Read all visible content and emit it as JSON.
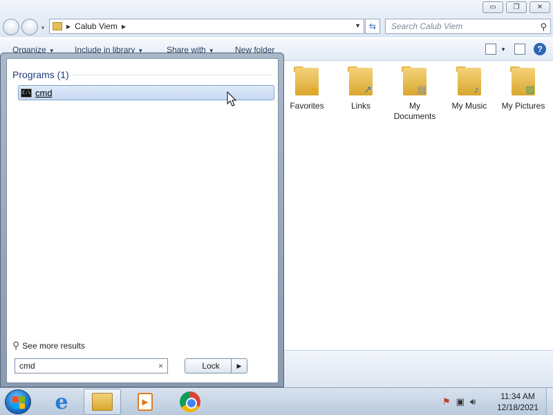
{
  "window": {
    "buttons": {
      "minimize": "▭",
      "restore": "❐",
      "close": "✕"
    },
    "address": {
      "segments": [
        "Calub Viem"
      ]
    },
    "search_placeholder": "Search Calub Viem"
  },
  "toolbar": {
    "organize": "Organize",
    "include_library": "Include in library",
    "share_with": "Share with",
    "new_folder": "New folder"
  },
  "folders": [
    {
      "label": "Favorites",
      "icon": "favorites-folder-icon",
      "badge": "★",
      "badge_color": "#e9a91a"
    },
    {
      "label": "Links",
      "icon": "links-folder-icon",
      "badge": "↗",
      "badge_color": "#2a78d0"
    },
    {
      "label": "My Documents",
      "icon": "documents-folder-icon",
      "badge": "▤",
      "badge_color": "#7a8aa0"
    },
    {
      "label": "My Music",
      "icon": "music-folder-icon",
      "badge": "♪",
      "badge_color": "#2a78d0"
    },
    {
      "label": "My Pictures",
      "icon": "pictures-folder-icon",
      "badge": "▨",
      "badge_color": "#3b9c7a"
    }
  ],
  "start_menu": {
    "heading": "Programs (1)",
    "results": [
      {
        "label": "cmd",
        "icon": "cmd-icon"
      }
    ],
    "see_more": "See more results",
    "search_value": "cmd",
    "clear_glyph": "×",
    "lock_label": "Lock",
    "arrow_glyph": "▶"
  },
  "taskbar": {
    "clock_time": "11:34 AM",
    "clock_date": "12/18/2021"
  },
  "colors": {
    "selection": "#c6daf3",
    "heading": "#1e3c7a"
  }
}
